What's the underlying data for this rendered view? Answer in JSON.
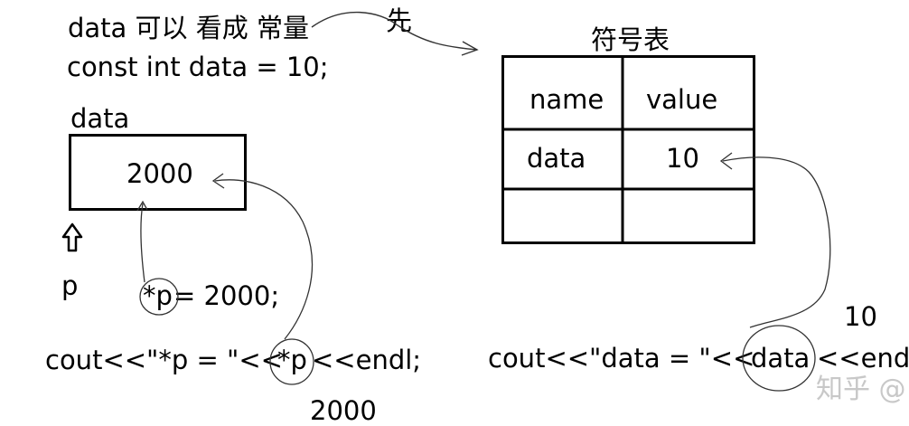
{
  "left": {
    "line1": "data 可以 看成 常量",
    "line2": "const int data = 10;",
    "box_label": "data",
    "box_value": "2000",
    "pointer_label": "p",
    "assign_code_prefix": "*p",
    "assign_code_rest": " = 2000;",
    "cout_prefix": "cout<<\"*p = \"<<",
    "cout_mid": "*p",
    "cout_suffix": "<<endl;",
    "output": "2000"
  },
  "arrow_note": "先",
  "symbol_table": {
    "title": "符号表",
    "headers": [
      "name",
      "value"
    ],
    "rows": [
      [
        "data",
        "10"
      ],
      [
        "",
        ""
      ]
    ]
  },
  "right": {
    "output": "10",
    "cout_prefix": "cout<<\"data = \"<<",
    "cout_mid": "data",
    "cout_suffix": "<<endl"
  },
  "watermark": "知乎 @"
}
